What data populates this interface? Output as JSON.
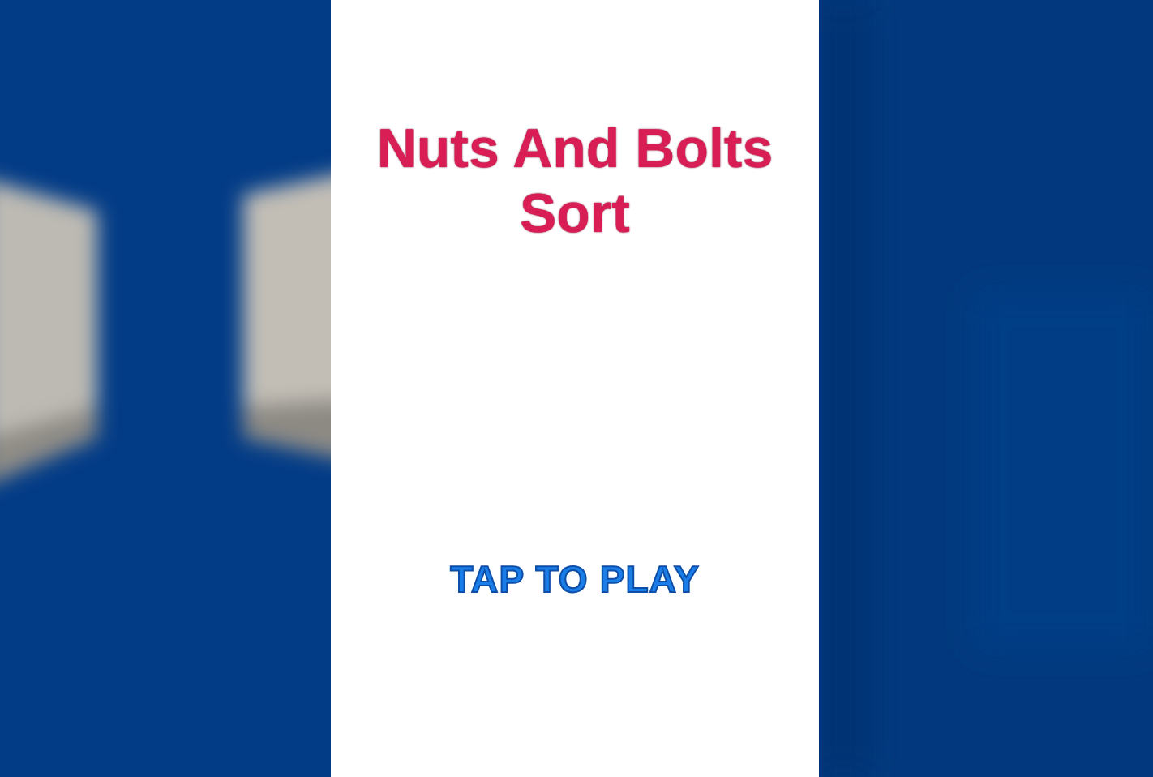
{
  "title": "Nuts And Bolts Sort",
  "play_prompt": "TAP TO PLAY"
}
